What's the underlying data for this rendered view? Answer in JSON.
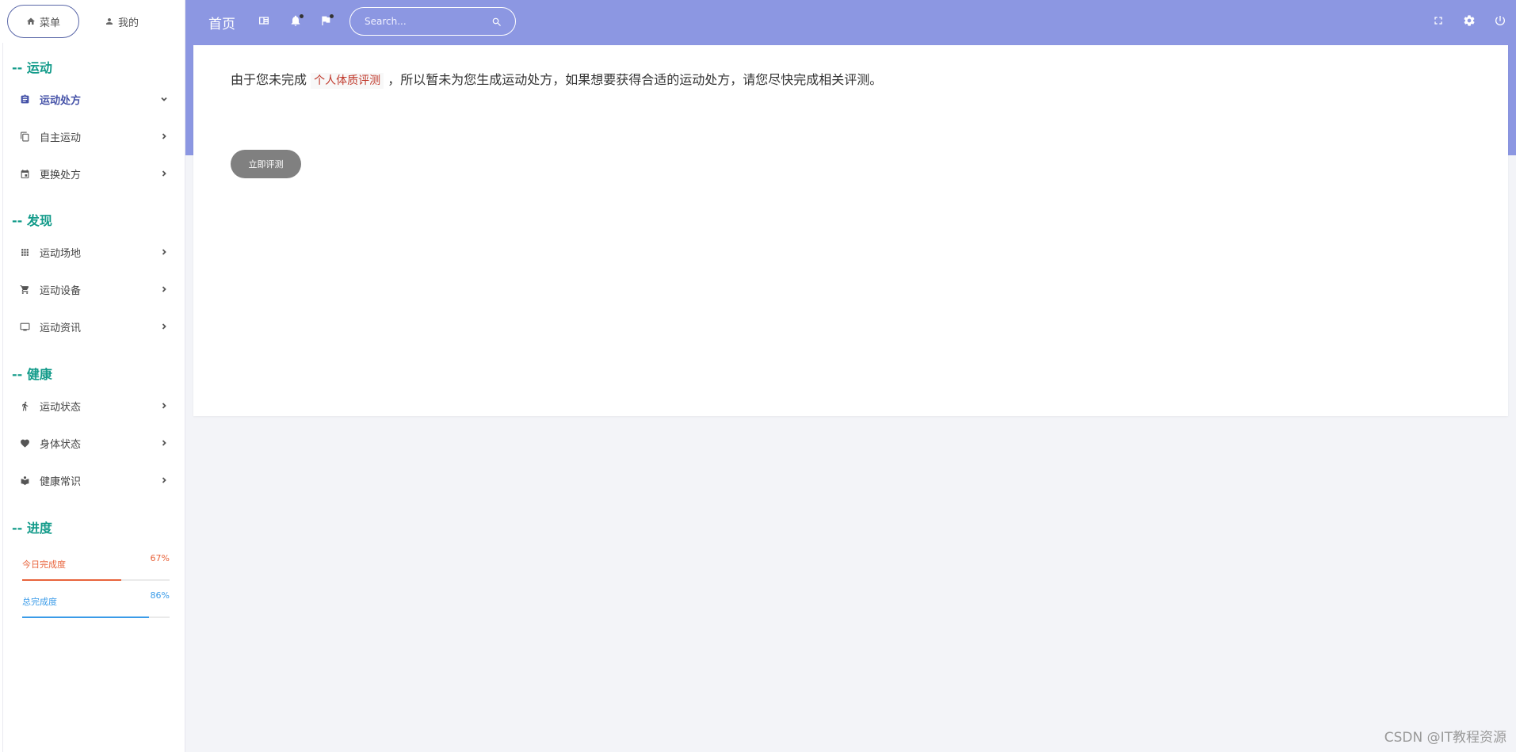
{
  "sidebar": {
    "tabs": [
      {
        "label": "菜单",
        "icon": "home-icon"
      },
      {
        "label": "我的",
        "icon": "user-icon"
      }
    ],
    "sections": [
      {
        "title": "-- 运动"
      },
      {
        "title": "-- 发现"
      },
      {
        "title": "-- 健康"
      },
      {
        "title": "-- 进度"
      }
    ],
    "items": [
      {
        "label": "运动处方",
        "icon": "clipboard-icon",
        "active": true
      },
      {
        "label": "自主运动",
        "icon": "copy-icon"
      },
      {
        "label": "更换处方",
        "icon": "calendar-icon"
      },
      {
        "label": "运动场地",
        "icon": "grid-icon"
      },
      {
        "label": "运动设备",
        "icon": "cart-icon"
      },
      {
        "label": "运动资讯",
        "icon": "monitor-icon"
      },
      {
        "label": "运动状态",
        "icon": "running-icon"
      },
      {
        "label": "身体状态",
        "icon": "heart-icon"
      },
      {
        "label": "健康常识",
        "icon": "book-icon"
      }
    ],
    "progress": [
      {
        "label": "今日完成度",
        "value": "67%",
        "fraction": 0.67,
        "color": "#e8643c"
      },
      {
        "label": "总完成度",
        "value": "86%",
        "fraction": 0.86,
        "color": "#3a9be8"
      }
    ]
  },
  "header": {
    "home_label": "首页",
    "search_placeholder": "Search..."
  },
  "main": {
    "notice_before": "由于您未完成",
    "notice_link": "个人体质评测",
    "notice_after": "，所以暂未为您生成运动处方，如果想要获得合适的运动处方，请您尽快完成相关评测。",
    "button_label": "立即评测"
  },
  "watermark": "CSDN @IT教程资源",
  "colors": {
    "header_bg": "#8c97e2",
    "section_title": "#139b8a",
    "active_item": "#4552a8",
    "button": "#808080"
  }
}
